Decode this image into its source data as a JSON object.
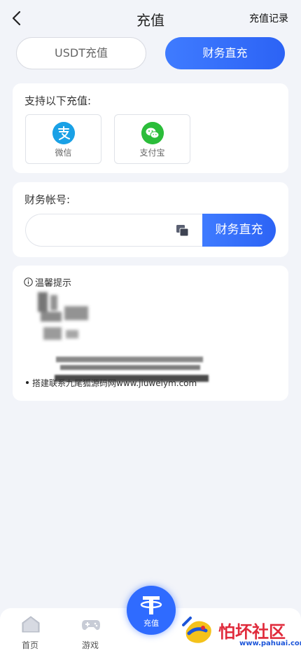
{
  "header": {
    "title": "充值",
    "right_link": "充值记录"
  },
  "tabs": [
    {
      "label": "USDT充值",
      "active": false
    },
    {
      "label": "财务直充",
      "active": true
    }
  ],
  "payment_methods": {
    "title": "支持以下充值:",
    "items": [
      {
        "label": "微信",
        "icon": "alipay-icon"
      },
      {
        "label": "支付宝",
        "icon": "wechat-icon"
      }
    ]
  },
  "account": {
    "title": "财务帐号:",
    "value": "",
    "placeholder": "",
    "submit_label": "财务直充"
  },
  "tips": {
    "title": "温馨提示",
    "lines": [
      "搭建联系九尾狐源码网www.jiuweiym.com"
    ]
  },
  "bottom_nav": {
    "home_label": "首页",
    "games_label": "游戏",
    "center_label": "充值"
  },
  "watermark": {
    "text": "怕坏社区",
    "url": "www.pahuai.com"
  },
  "colors": {
    "accent": "#3373ff",
    "background": "#f2f4f9"
  }
}
